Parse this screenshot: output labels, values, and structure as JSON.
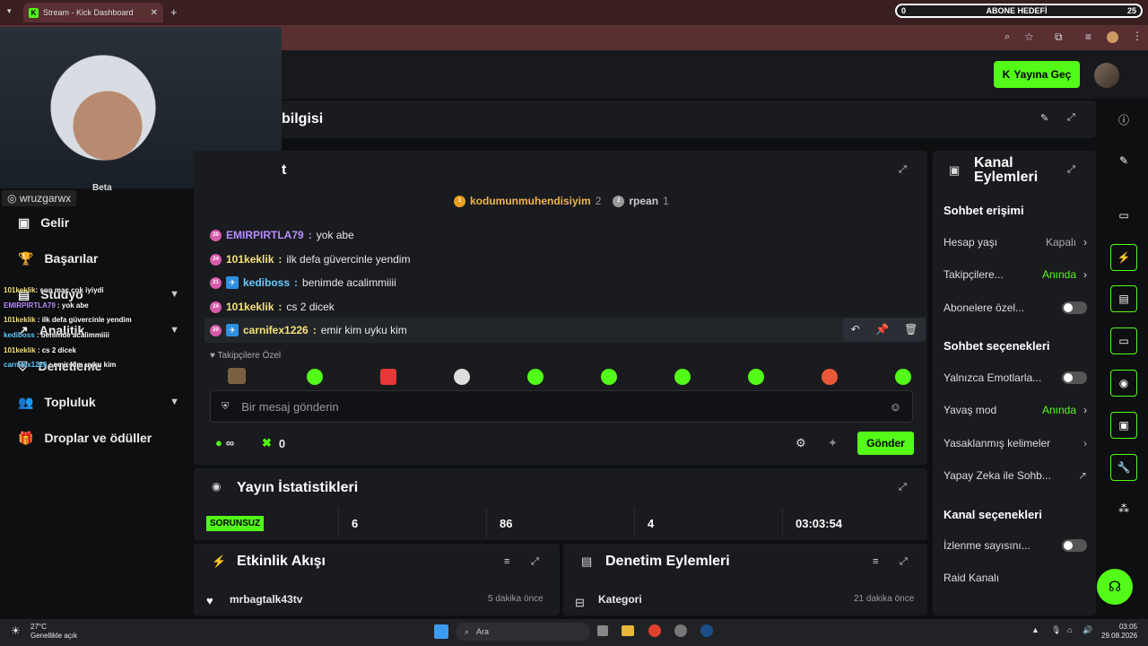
{
  "browser": {
    "tab_title": "Stream - Kick Dashboard",
    "sub_goal": {
      "start": "0",
      "label": "ABONE HEDEFİ",
      "end": "25"
    }
  },
  "header": {
    "golive_label": "Yayına Geç"
  },
  "webcam": {
    "username": "wruzgarwx",
    "beta": "Beta"
  },
  "sidebar": {
    "items": [
      {
        "label": "Gelir"
      },
      {
        "label": "Başarılar"
      },
      {
        "label": "Stüdyo"
      },
      {
        "label": "Analitik"
      },
      {
        "label": "Denetleme"
      },
      {
        "label": "Topluluk"
      },
      {
        "label": "Droplar ve ödüller"
      }
    ]
  },
  "overlay_chat": [
    {
      "user": "101keklik",
      "text": "son maç çok iyiydi"
    },
    {
      "user": "EMIRPIRTLA79",
      "text": "yok abe"
    },
    {
      "user": "101keklik",
      "text": "ilk defa güvercinle yendim"
    },
    {
      "user": "kediboss",
      "text": "benimde acalimmiiii"
    },
    {
      "user": "101keklik",
      "text": "cs 2 dicek"
    },
    {
      "user": "carnifex1226",
      "text": "emir kim uyku kim"
    }
  ],
  "stream_info": {
    "title": "bilgisi"
  },
  "chat": {
    "title": "t",
    "top_gifters": [
      {
        "rank": "1",
        "name": "kodumunmuhendisiyim",
        "count": "2"
      },
      {
        "rank": "2",
        "name": "rpean",
        "count": "1"
      }
    ],
    "messages": [
      {
        "badge": "20",
        "user": "EMIRPIRTLA79",
        "color": "#b98cff",
        "text": "yok abe",
        "verified": false
      },
      {
        "badge": "24",
        "user": "101keklik",
        "color": "#f6e27a",
        "text": "ilk defa güvercinle yendim",
        "verified": false
      },
      {
        "badge": "21",
        "user": "kediboss",
        "color": "#66ccff",
        "text": "benimde acalimmiiii",
        "verified": true
      },
      {
        "badge": "24",
        "user": "101keklik",
        "color": "#f6e27a",
        "text": "cs 2 dicek",
        "verified": false
      },
      {
        "badge": "20",
        "user": "carnifex1226",
        "color": "#f6e27a",
        "text": "emir kim uyku kim",
        "verified": true
      }
    ],
    "emote_label": "Takipçilere Özel",
    "input_placeholder": "Bir mesaj gönderin",
    "viewers_symbol": "∞",
    "points": "0",
    "send_label": "Gönder"
  },
  "stats": {
    "title": "Yayın İstatistikleri",
    "status": "SORUNSUZ",
    "values": [
      "6",
      "86",
      "4",
      "03:03:54"
    ]
  },
  "activity": {
    "title": "Etkinlik Akışı",
    "item_user": "mrbagtalk43tv",
    "item_time": "5 dakika önce"
  },
  "moderation": {
    "title": "Denetim Eylemleri",
    "item_label": "Kategori",
    "item_time": "21 dakika önce"
  },
  "channel_actions": {
    "title_line1": "Kanal",
    "title_line2": "Eylemleri",
    "chat_access": "Sohbet erişimi",
    "account_age": "Hesap yaşı",
    "account_age_val": "Kapalı",
    "followers": "Takipçilere...",
    "followers_val": "Anında",
    "subs_only": "Abonelere özel...",
    "chat_options": "Sohbet seçenekleri",
    "emotes_only": "Yalnızca Emotlarla...",
    "slow_mode": "Yavaş mod",
    "slow_mode_val": "Anında",
    "banned_words": "Yasaklanmış kelimeler",
    "ai_chat": "Yapay Zeka ile Sohb...",
    "channel_options": "Kanal seçenekleri",
    "view_count": "İzlenme sayısını...",
    "raid": "Raid Kanalı"
  },
  "taskbar": {
    "weather_temp": "27°C",
    "weather_desc": "Genellikle açık",
    "search": "Ara",
    "time": "03:05",
    "date": "29.08.2026"
  },
  "colors": {
    "accent": "#53fc18",
    "panel": "#191b1f"
  }
}
